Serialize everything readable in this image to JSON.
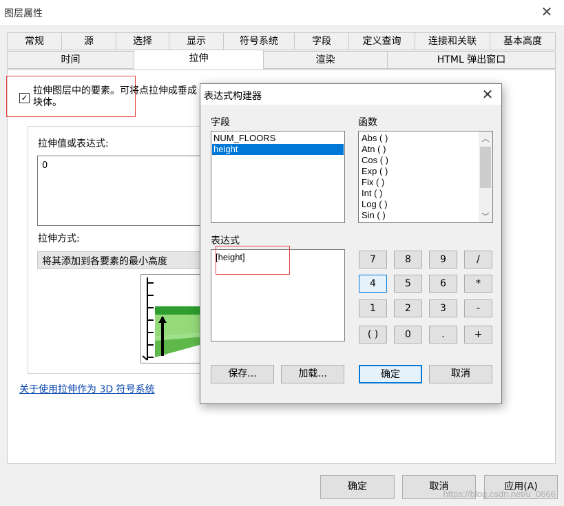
{
  "window": {
    "title": "图层属性"
  },
  "tabs_row1": [
    "常规",
    "源",
    "选择",
    "显示",
    "符号系统",
    "字段",
    "定义查询",
    "连接和关联",
    "基本高度"
  ],
  "tabs_row2": [
    "时间",
    "拉伸",
    "渲染",
    "HTML 弹出窗口"
  ],
  "active_tab": "拉伸",
  "extrusion": {
    "checkbox_checked": true,
    "checkbox_mark": "✓",
    "checkbox_label": "拉伸图层中的要素。可将点拉伸成垂成块体。",
    "value_label": "拉伸值或表达式:",
    "value": "0",
    "method_label": "拉伸方式:",
    "method_value": "将其添加到各要素的最小高度",
    "help_link": "关于使用拉伸作为 3D 符号系统"
  },
  "buttons": {
    "ok": "确定",
    "cancel": "取消",
    "apply": "应用(A)"
  },
  "watermark": "https://blog.csdn.net/u_0666",
  "dialog": {
    "title": "表达式构建器",
    "close_icon": "close-icon",
    "fields_label": "字段",
    "fields": [
      "NUM_FLOORS",
      "height"
    ],
    "selected_field": "height",
    "functions_label": "函数",
    "functions": [
      "Abs ( )",
      "Atn ( )",
      "Cos ( )",
      "Exp ( )",
      "Fix ( )",
      "Int ( )",
      "Log ( )",
      "Sin ( )"
    ],
    "expression_label": "表达式",
    "expression": "[height]",
    "calc_buttons": [
      "7",
      "8",
      "9",
      "/",
      "4",
      "5",
      "6",
      "*",
      "1",
      "2",
      "3",
      "-",
      "( )",
      "0",
      ".",
      "+"
    ],
    "focused_calc_button": "4",
    "save": "保存...",
    "load": "加载...",
    "ok": "确定",
    "cancel": "取消"
  },
  "colors": {
    "selection": "#0078d7",
    "highlight_box": "#e8413b",
    "link": "#0645ad"
  }
}
